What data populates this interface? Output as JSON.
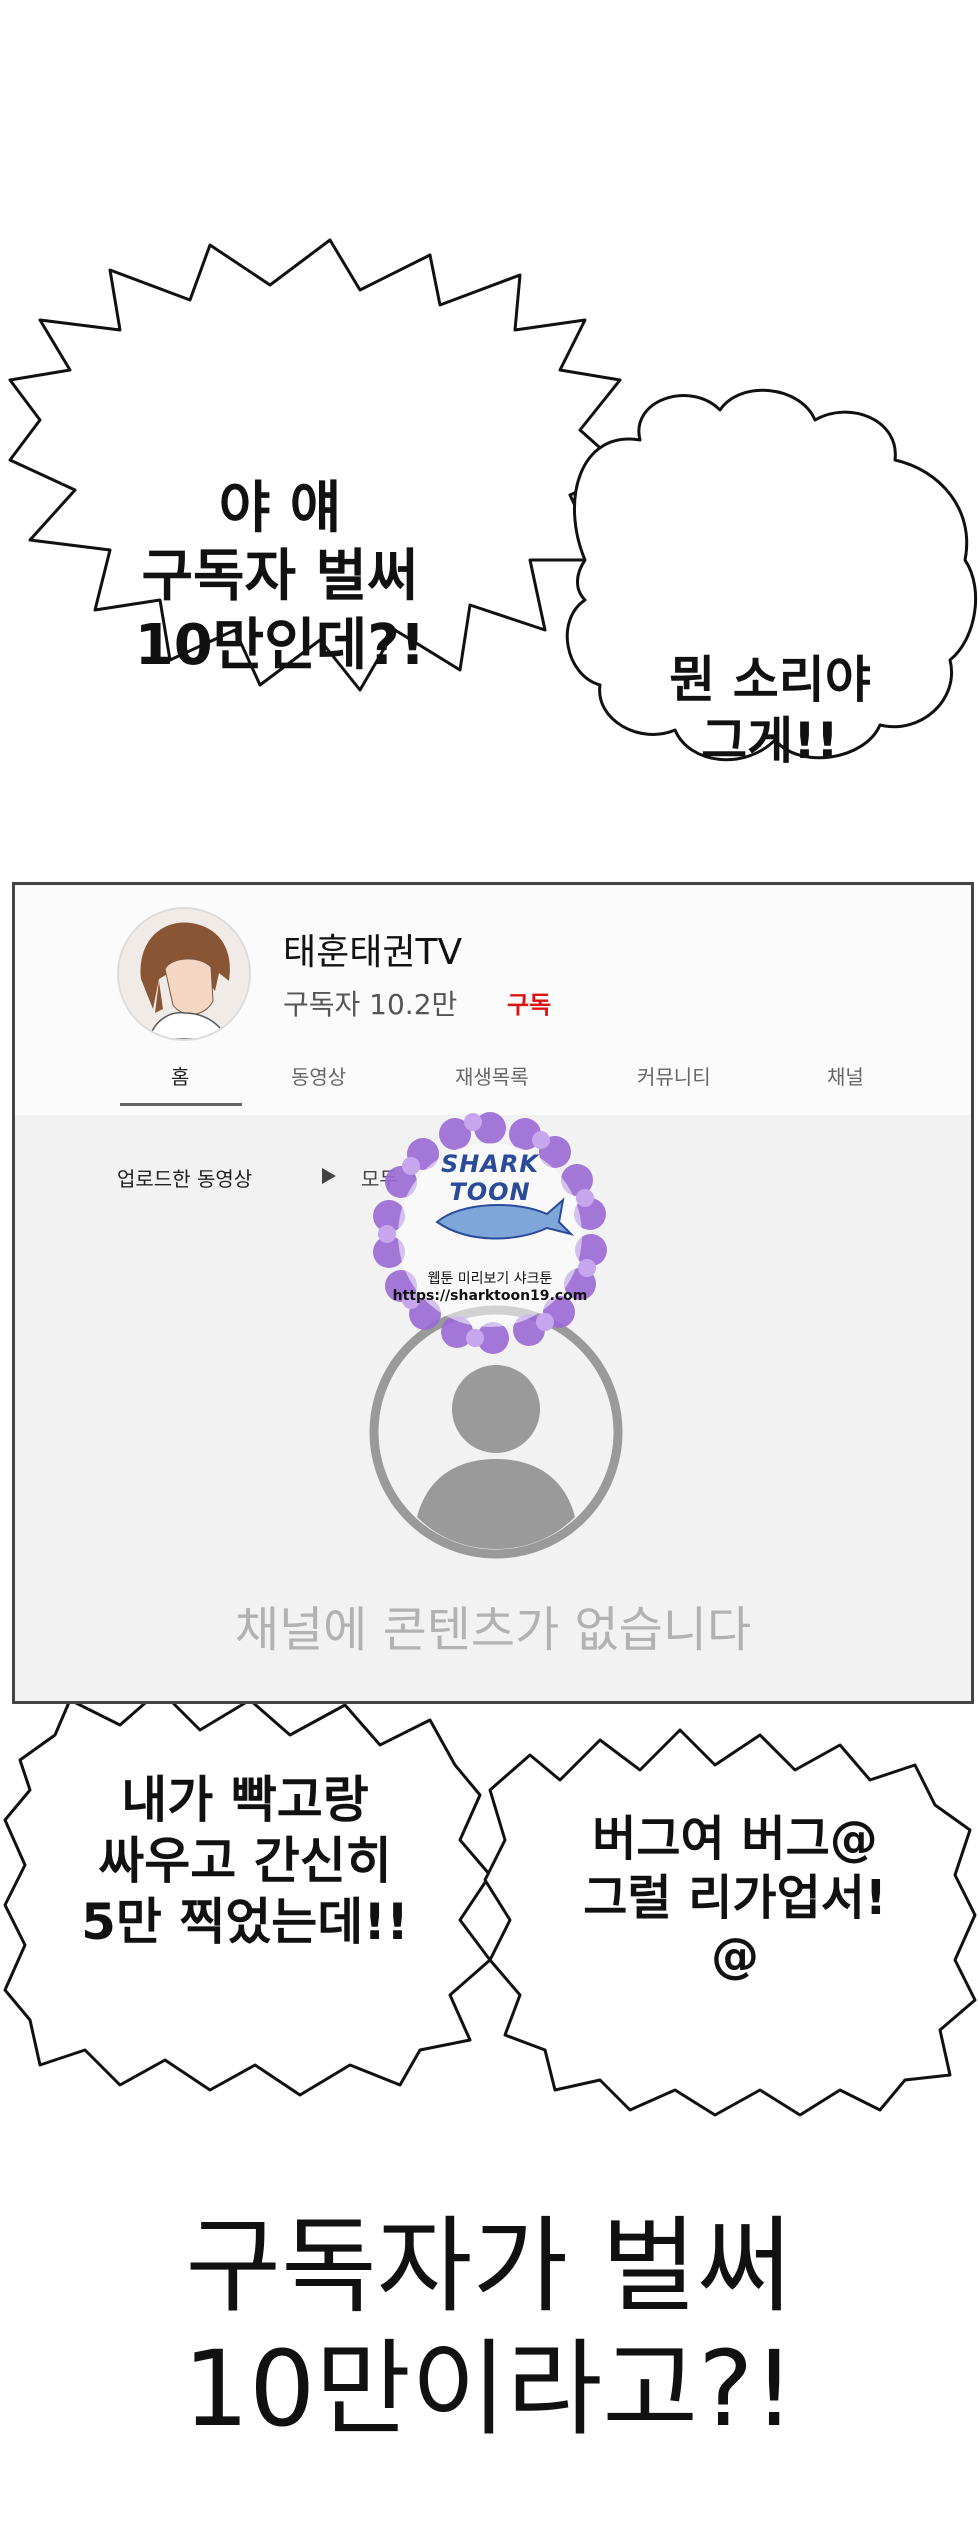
{
  "bubbles": {
    "top_left": [
      "야 얘",
      "구독자 벌써",
      "10만인데?!"
    ],
    "top_right": [
      "뭔 소리야",
      "그게!!"
    ],
    "bottom_left": [
      "내가 빡고랑",
      "싸우고 간신히",
      "5만 찍었는데!!"
    ],
    "bottom_right": [
      "버그여 버그@",
      "그럴 리가업서!",
      "@"
    ]
  },
  "channel": {
    "name": "태훈태권TV",
    "subscribers": "구독자 10.2만",
    "subscribe_label": "구독",
    "tabs": [
      "홈",
      "동영상",
      "재생목록",
      "커뮤니티",
      "채널"
    ],
    "active_tab": "홈",
    "section_label": "업로드한 동영상",
    "sort_label": "모두",
    "empty_message": "채널에 콘텐츠가 없습니다"
  },
  "watermark": {
    "logo_text": "SHARK TOON",
    "tagline": "웹툰 미리보기 샤크툰",
    "url": "https://sharktoon19.com"
  },
  "caption": [
    "구독자가 벌써",
    "10만이라고?!"
  ],
  "colors": {
    "subscribe": "#dd1111",
    "empty_text": "#b2b2b2",
    "watermark_flower": "#9b6ad6"
  }
}
